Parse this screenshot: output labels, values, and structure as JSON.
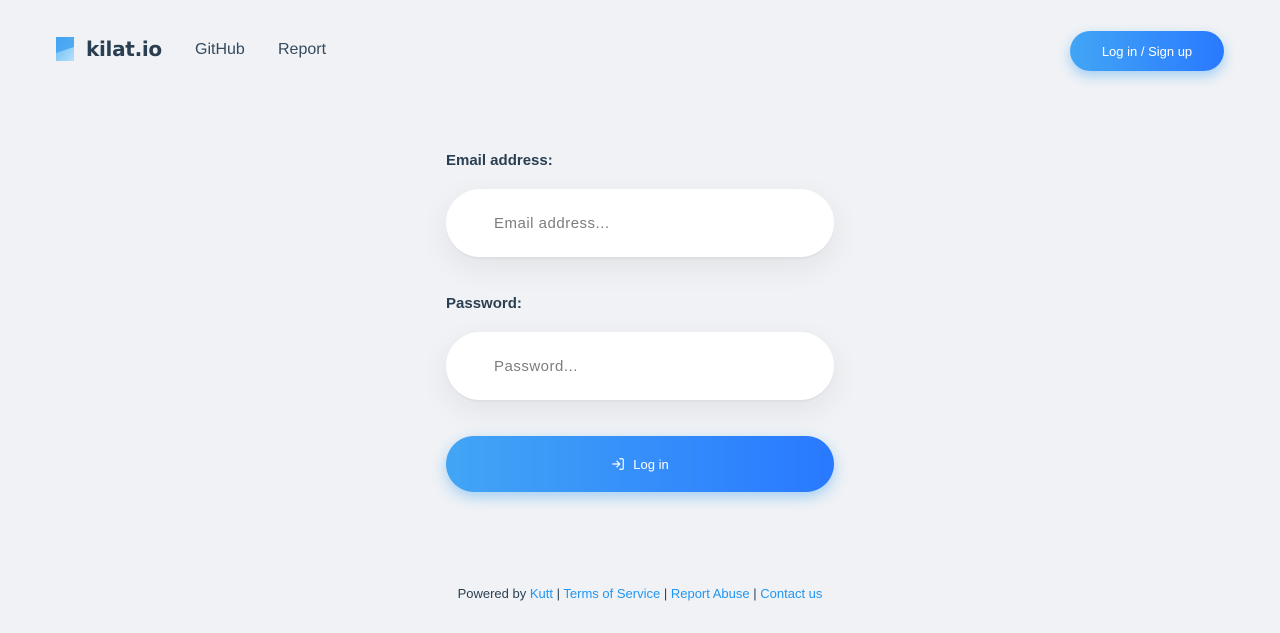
{
  "header": {
    "logo_text": "kilat.io",
    "nav": {
      "github": "GitHub",
      "report": "Report"
    },
    "auth_button": "Log in / Sign up"
  },
  "form": {
    "email_label": "Email address:",
    "email_placeholder": "Email address...",
    "email_value": "",
    "password_label": "Password:",
    "password_placeholder": "Password...",
    "password_value": "",
    "submit_label": "Log in",
    "submit_icon": "log-in-icon"
  },
  "footer": {
    "powered_by": "Powered by",
    "kutt": "Kutt",
    "separator": "|",
    "terms": "Terms of Service",
    "report_abuse": "Report Abuse",
    "contact": "Contact us"
  },
  "colors": {
    "background": "#f0f2f5",
    "accent_start": "#42a5f5",
    "accent_end": "#2979ff",
    "link": "#2196f3",
    "text": "#2a3f52"
  }
}
